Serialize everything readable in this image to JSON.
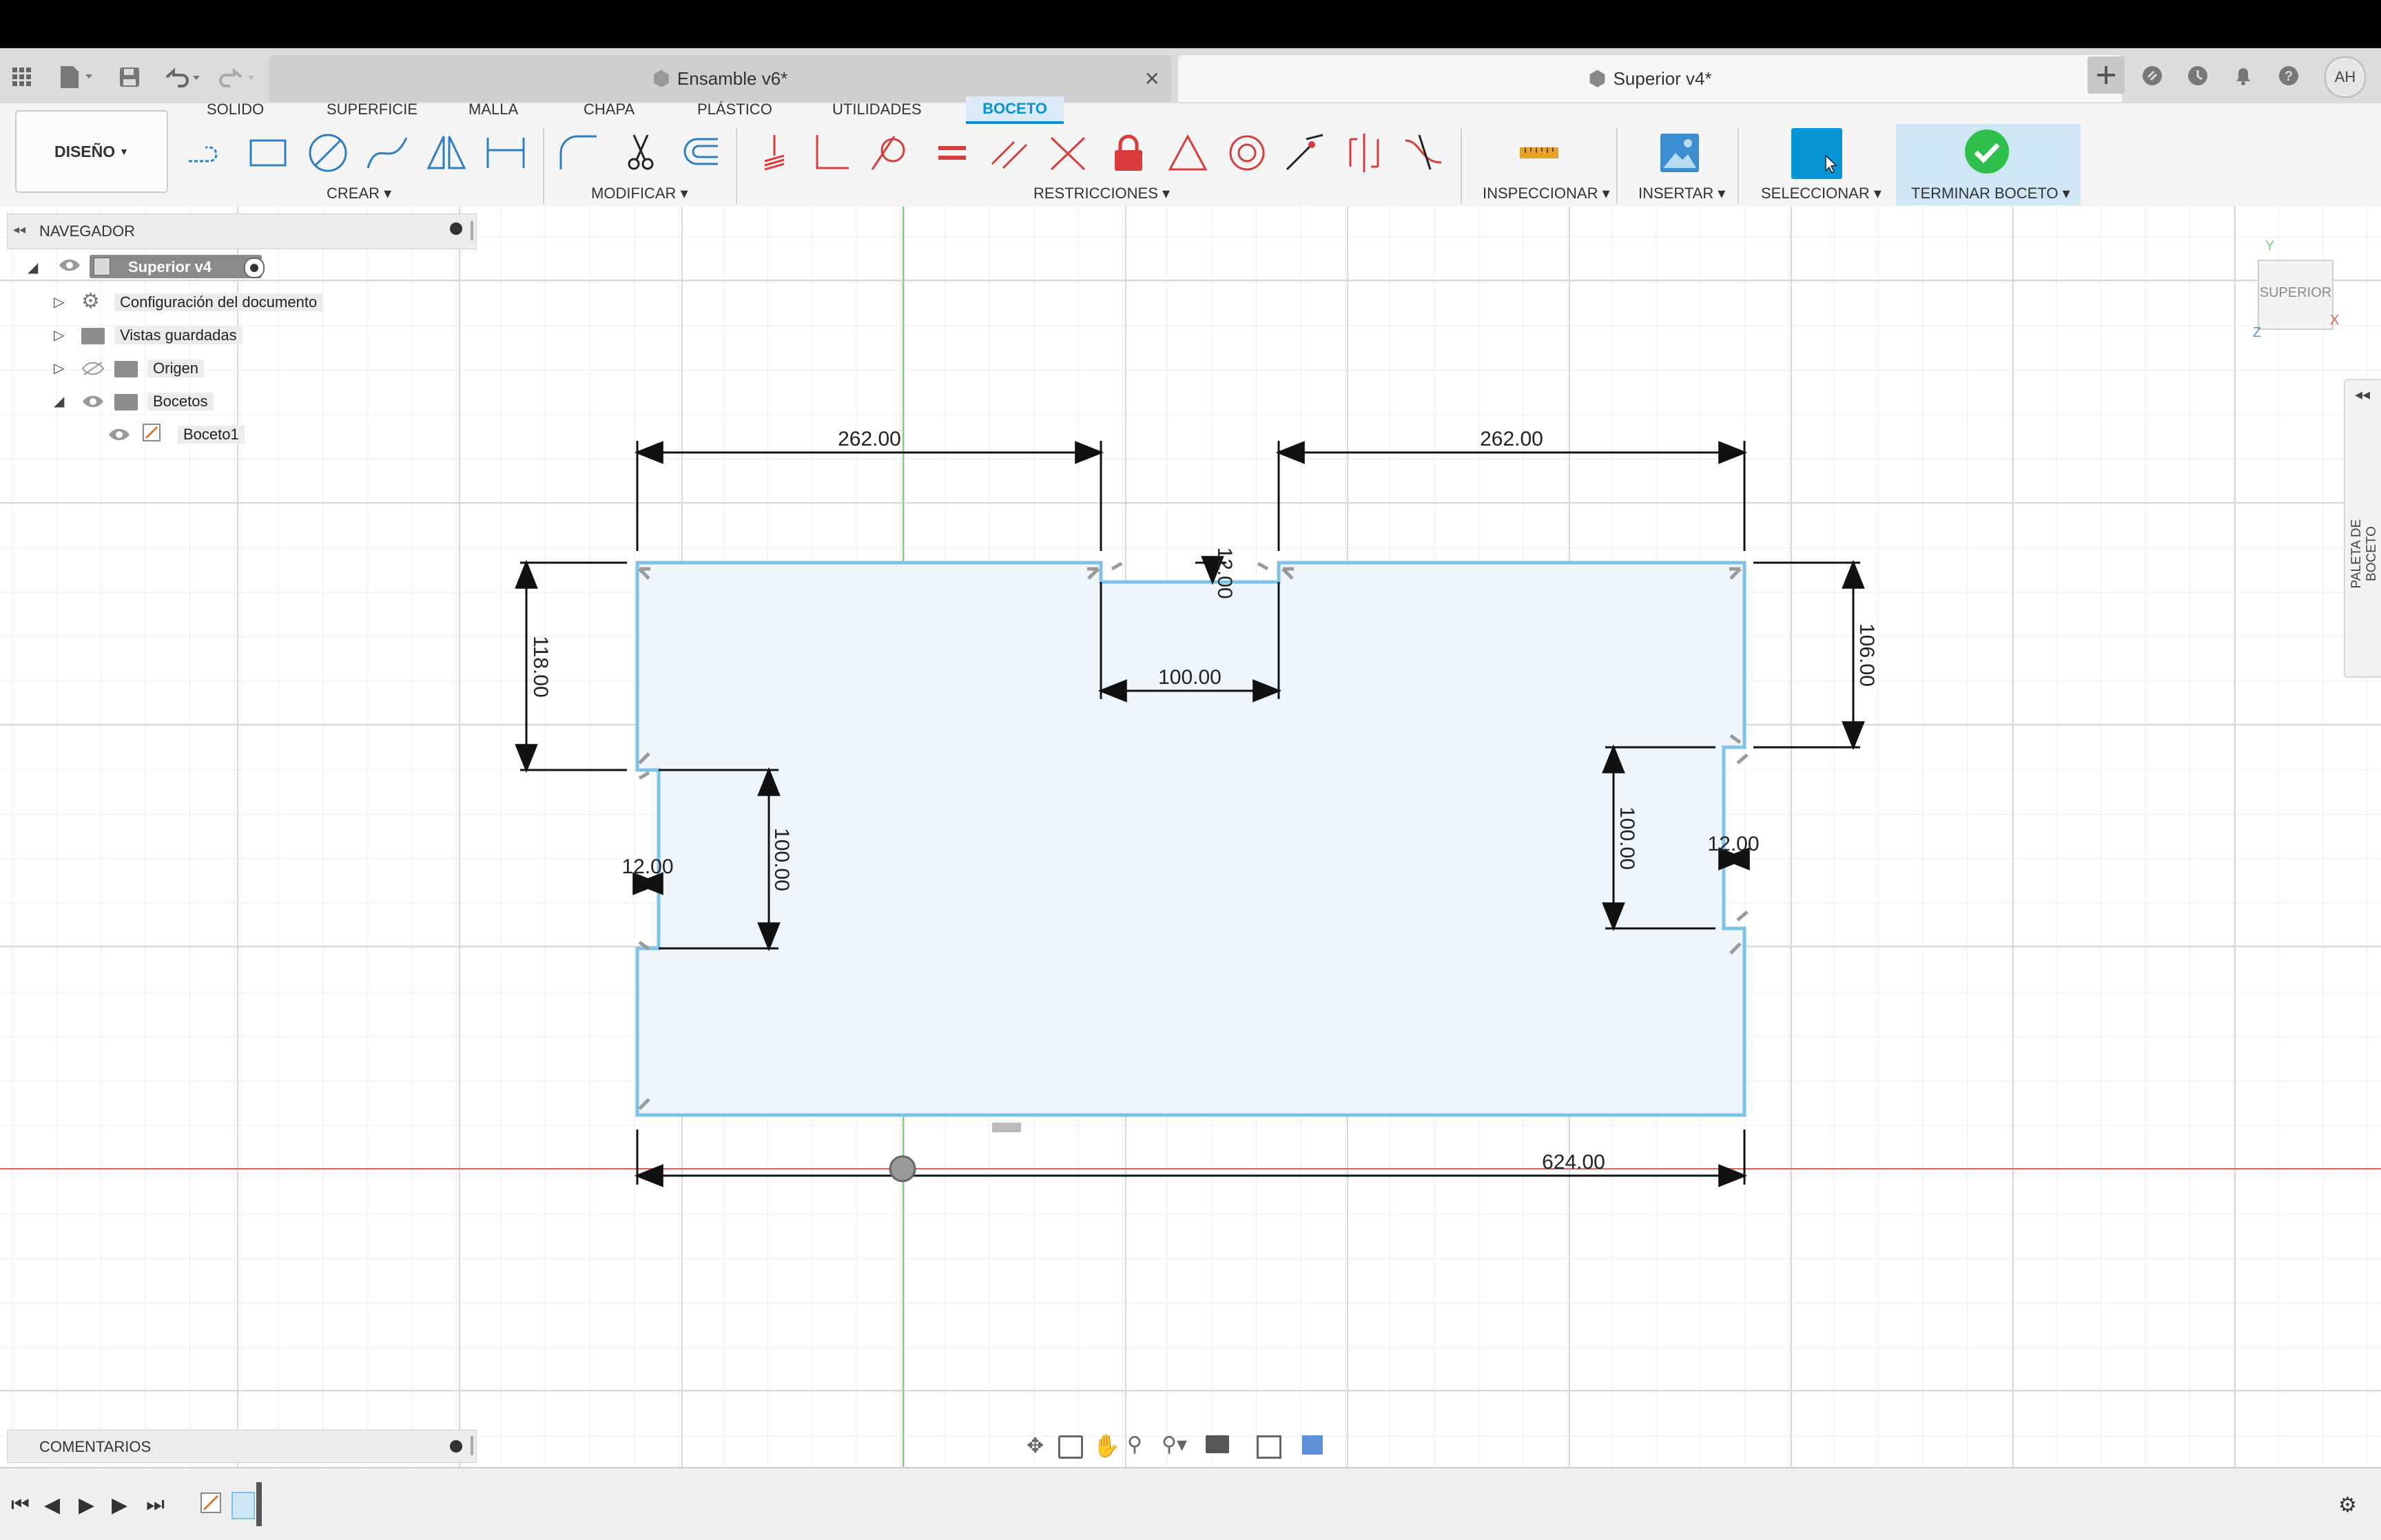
{
  "tabs": [
    {
      "label": "Ensamble v6*",
      "active": false
    },
    {
      "label": "Superior v4*",
      "active": true
    }
  ],
  "user_initials": "AH",
  "workspace": {
    "label": "DISEÑO"
  },
  "workspace_tabs": [
    "SOLIDO",
    "SUPERFICIE",
    "MALLA",
    "CHAPA",
    "PLÁSTICO",
    "UTILIDADES",
    "BOCETO"
  ],
  "active_workspace_tab": "BOCETO",
  "toolbar_groups": {
    "crear": "CREAR",
    "modificar": "MODIFICAR",
    "restricciones": "RESTRICCIONES",
    "inspeccionar": "INSPECCIONAR",
    "insertar": "INSERTAR",
    "seleccionar": "SELECCIONAR",
    "terminar": "TERMINAR BOCETO"
  },
  "navigator": {
    "title": "NAVEGADOR",
    "root": "Superior v4",
    "items": [
      "Configuración del documento",
      "Vistas guardadas",
      "Origen",
      "Bocetos",
      "Boceto1"
    ]
  },
  "comments": {
    "title": "COMENTARIOS"
  },
  "viewcube": {
    "face": "SUPERIOR",
    "axis_x": "X",
    "axis_y": "Y",
    "axis_z": "Z"
  },
  "palette": {
    "label": "PALETA DE BOCETO"
  },
  "dimensions": {
    "top_left_width": "262.00",
    "top_right_width": "262.00",
    "notch_depth": "12.00",
    "notch_width": "100.00",
    "left_offset": "118.00",
    "left_notch_depth": "12.00",
    "left_notch_height": "100.00",
    "right_offset": "106.00",
    "right_notch_height": "100.00",
    "right_notch_depth": "12.00",
    "total_width": "624.00"
  },
  "colors": {
    "accent": "#0696d7",
    "sketch_fill": "#eef6fc",
    "sketch_line": "#7cc3ea",
    "finish_green": "#2ec04a",
    "axis_red": "#e06060",
    "axis_green": "#7ed07e"
  }
}
